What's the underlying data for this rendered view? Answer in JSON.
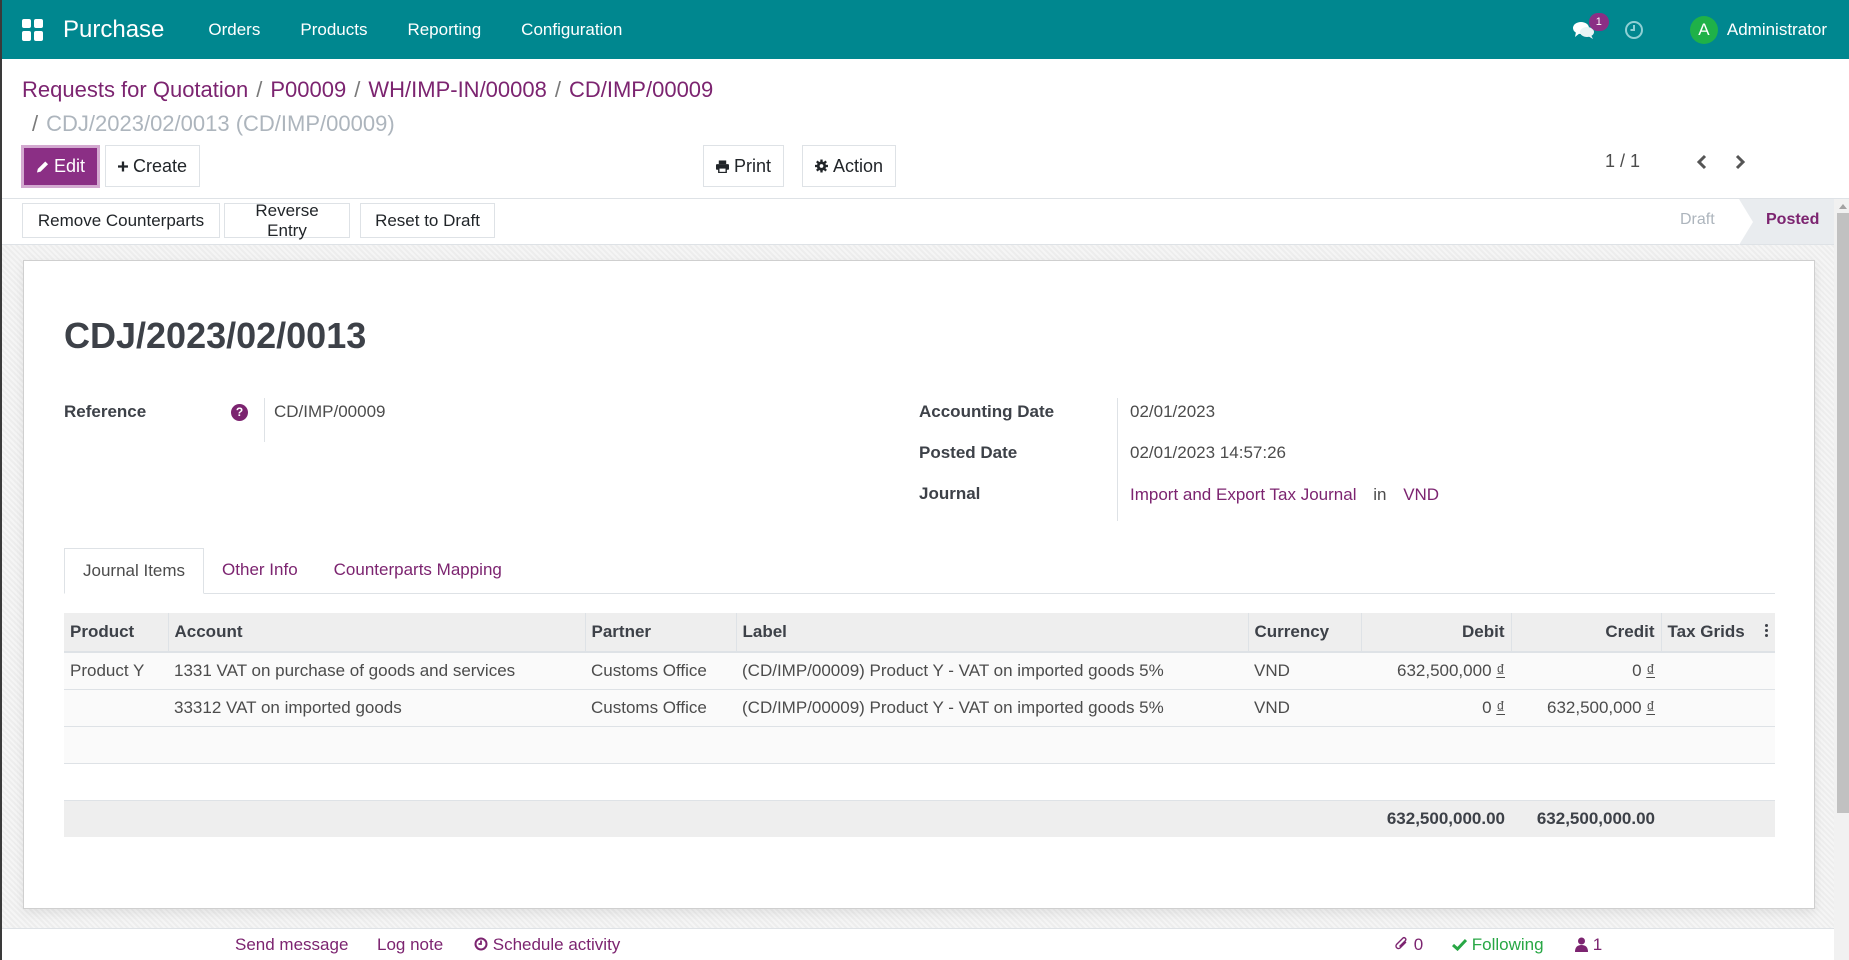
{
  "navbar": {
    "app_name": "Purchase",
    "menu": [
      "Orders",
      "Products",
      "Reporting",
      "Configuration"
    ],
    "chat_badge": "1",
    "avatar_initial": "A",
    "user_name": "Administrator",
    "brand_color": "#00878f"
  },
  "breadcrumb": {
    "items": [
      "Requests for Quotation",
      "P00009",
      "WH/IMP-IN/00008",
      "CD/IMP/00009"
    ],
    "current": "CDJ/2023/02/0013 (CD/IMP/00009)",
    "separator": "/"
  },
  "toolbar": {
    "edit_label": "Edit",
    "create_label": "Create",
    "print_label": "Print",
    "action_label": "Action"
  },
  "pager": {
    "value": "1 / 1"
  },
  "statusbar": {
    "buttons": [
      "Remove Counterparts",
      "Reverse Entry",
      "Reset to Draft"
    ],
    "stages": [
      "Draft",
      "Posted"
    ],
    "current_stage": "Posted"
  },
  "record": {
    "title": "CDJ/2023/02/0013",
    "reference_label": "Reference",
    "reference_help": "?",
    "reference_value": "CD/IMP/00009",
    "accounting_date_label": "Accounting Date",
    "accounting_date": "02/01/2023",
    "posted_date_label": "Posted Date",
    "posted_date": "02/01/2023 14:57:26",
    "journal_label": "Journal",
    "journal": "Import and Export Tax Journal",
    "journal_in": "in",
    "journal_currency": "VND"
  },
  "tabs": [
    "Journal Items",
    "Other Info",
    "Counterparts Mapping"
  ],
  "active_tab": "Journal Items",
  "table": {
    "columns": [
      "Product",
      "Account",
      "Partner",
      "Label",
      "Currency",
      "Debit",
      "Credit",
      "Tax Grids"
    ],
    "rows": [
      {
        "product": "Product Y",
        "account": "1331 VAT on purchase of goods and services",
        "partner": "Customs Office",
        "label": "(CD/IMP/00009) Product Y - VAT on imported goods 5%",
        "currency": "VND",
        "debit": "632,500,000",
        "credit": "0",
        "tax_grids": ""
      },
      {
        "product": "",
        "account": "33312 VAT on imported goods",
        "partner": "Customs Office",
        "label": "(CD/IMP/00009) Product Y - VAT on imported goods 5%",
        "currency": "VND",
        "debit": "0",
        "credit": "632,500,000",
        "tax_grids": ""
      }
    ],
    "currency_symbol": "₫",
    "total_debit": "632,500,000.00",
    "total_credit": "632,500,000.00"
  },
  "chatter": {
    "send_message": "Send message",
    "log_note": "Log note",
    "schedule_activity": "Schedule activity",
    "attachments_count": "0",
    "following_label": "Following",
    "followers_count": "1"
  }
}
